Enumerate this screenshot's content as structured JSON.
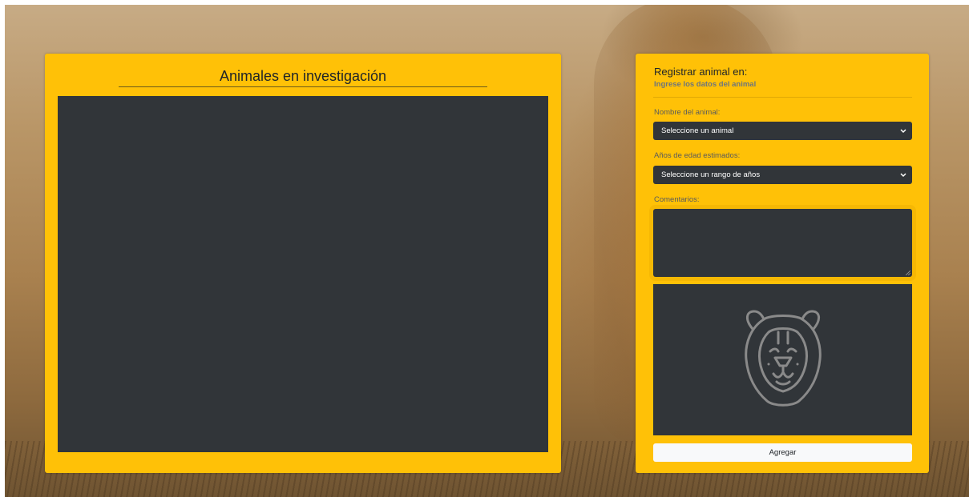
{
  "left_panel": {
    "title": "Animales en investigación"
  },
  "form": {
    "title": "Registrar animal en:",
    "subtitle": "Ingrese los datos del animal",
    "animal_name": {
      "label": "Nombre del animal:",
      "selected": "Seleccione un animal"
    },
    "age": {
      "label": "Años de edad estimados:",
      "selected": "Seleccione un rango de años"
    },
    "comments": {
      "label": "Comentarios:",
      "value": ""
    },
    "preview_icon": "lion-icon",
    "submit_label": "Agregar"
  },
  "colors": {
    "panel": "#ffc107",
    "dark": "#313539",
    "button": "#f8f9fa"
  }
}
